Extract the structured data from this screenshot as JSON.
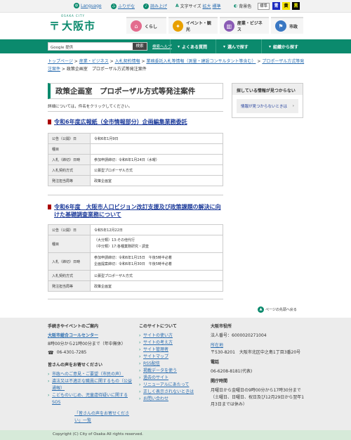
{
  "util": {
    "language": "Language",
    "furigana": "ふりがな",
    "yomiage": "読み上げ",
    "font_size_label": "文字サイズ",
    "font_large": "拡大",
    "font_standard": "標準",
    "bg_label": "背景色",
    "bg_standard": "標準",
    "bg_blue": "青",
    "bg_yellow": "黄",
    "bg_black": "黒"
  },
  "header": {
    "logo_sub": "OSAKA CITY",
    "logo_text": "大阪市",
    "nav": [
      {
        "label": "くらし",
        "icon": "⌂",
        "color": "#e36c8e"
      },
      {
        "label": "イベント・観光",
        "icon": "✦",
        "color": "#e8a000"
      },
      {
        "label": "産業・ビジネス",
        "icon": "▥",
        "color": "#8a5bb5"
      },
      {
        "label": "市政",
        "icon": "⚑",
        "color": "#3a78c3"
      }
    ]
  },
  "navbar": {
    "search_placeholder": "Google 提供",
    "search_button": "検索",
    "help": "検索ヘルプ",
    "btn1": "よくある質問",
    "btn2": "選んで探す",
    "btn3": "組織から探す"
  },
  "breadcrumb": {
    "items": [
      "トップページ",
      "産業・ビジネス",
      "入札契約情報",
      "業務委託入札等情報（測量・建設コンサルタント等含む）",
      "プロポーザル方式等発注案件"
    ],
    "current": "政策企画室　プロポーザル方式等発注案件"
  },
  "main": {
    "title": "政策企画室　プロポーザル方式等発注案件",
    "note": "詳細については，件名をクリックしてください。",
    "items": [
      {
        "title": "令和6年度広報紙（全市情報部分）企画編集業務委託",
        "rows": [
          {
            "k": "公告（公開）日",
            "v": "令和6年1月9日"
          },
          {
            "k": "種目",
            "v": ""
          },
          {
            "k": "入札（締切）日時",
            "v": "参加申請締切：令和6年1月24日（水曜）"
          },
          {
            "k": "入札契約方式",
            "v": "公募型プロポーザル方式"
          },
          {
            "k": "発注担当局等",
            "v": "政策企画室"
          }
        ]
      },
      {
        "title": "令和6年度　大阪市人口ビジョン改訂支援及び政策課題の解決に向けた基礎調査業務について",
        "rows": [
          {
            "k": "公告（公開）日",
            "v": "令和5年12月22日"
          },
          {
            "k": "種目",
            "v": "（大分類）13:その他代行\n（中分類）17:各種業務研究・調査"
          },
          {
            "k": "入札（締切）日時",
            "v": "参加申請締切：令和6年1月15日　午後5時半必着\n企画提案締切：令和6年1月30日　午後5時半必着"
          },
          {
            "k": "入札契約方式",
            "v": "公募型プロポーザル方式"
          },
          {
            "k": "発注担当局等",
            "v": "政策企画室"
          }
        ]
      }
    ]
  },
  "side": {
    "heading": "探している情報が見つからない",
    "link": "情報が見つからないときは"
  },
  "pagetop": "ページの先頭へ戻る",
  "footer": {
    "col1": {
      "heading": "手続きやイベントのご案内",
      "center": "大阪市総合コールセンター",
      "hours": "8時00分から21時00分まで（年中無休）",
      "tel": "06-4301-7285",
      "heading2": "皆さんの声をお寄せください",
      "links": [
        "市政へのご意見・ご要望（市民の声）",
        "違法又は不適正な職員に関するもの（公益通報）",
        "こどものいじめ、児童虐待疑いに関するSOS"
      ],
      "more": "「皆さんの声をお寄せください」一覧"
    },
    "col2": {
      "heading": "このサイトについて",
      "links": [
        "サイトの使い方",
        "サイトの考え方",
        "サイト管理者",
        "サイトマップ",
        "RSS配信",
        "掲載データを使う",
        "過去のサイト",
        "リニューアルにあたって",
        "正しく表示されないときは",
        "お問い合わせ"
      ]
    },
    "col3": {
      "heading": "大阪市役所",
      "corp": "法人番号：6000020271004",
      "loc_label": "所在地",
      "address": "〒530-8201　大阪市北区中之島1丁目3番20号",
      "tel_label": "電話",
      "tel": "06-6208-8181(代表)",
      "hours_label": "開庁時間",
      "hours": "月曜日から金曜日の9時00分から17時30分まで（土曜日、日曜日、祝日及び12月29日から翌年1月3日までは休み）"
    }
  },
  "copyright": "Copyright (C) City of Osaka All rights reserved."
}
